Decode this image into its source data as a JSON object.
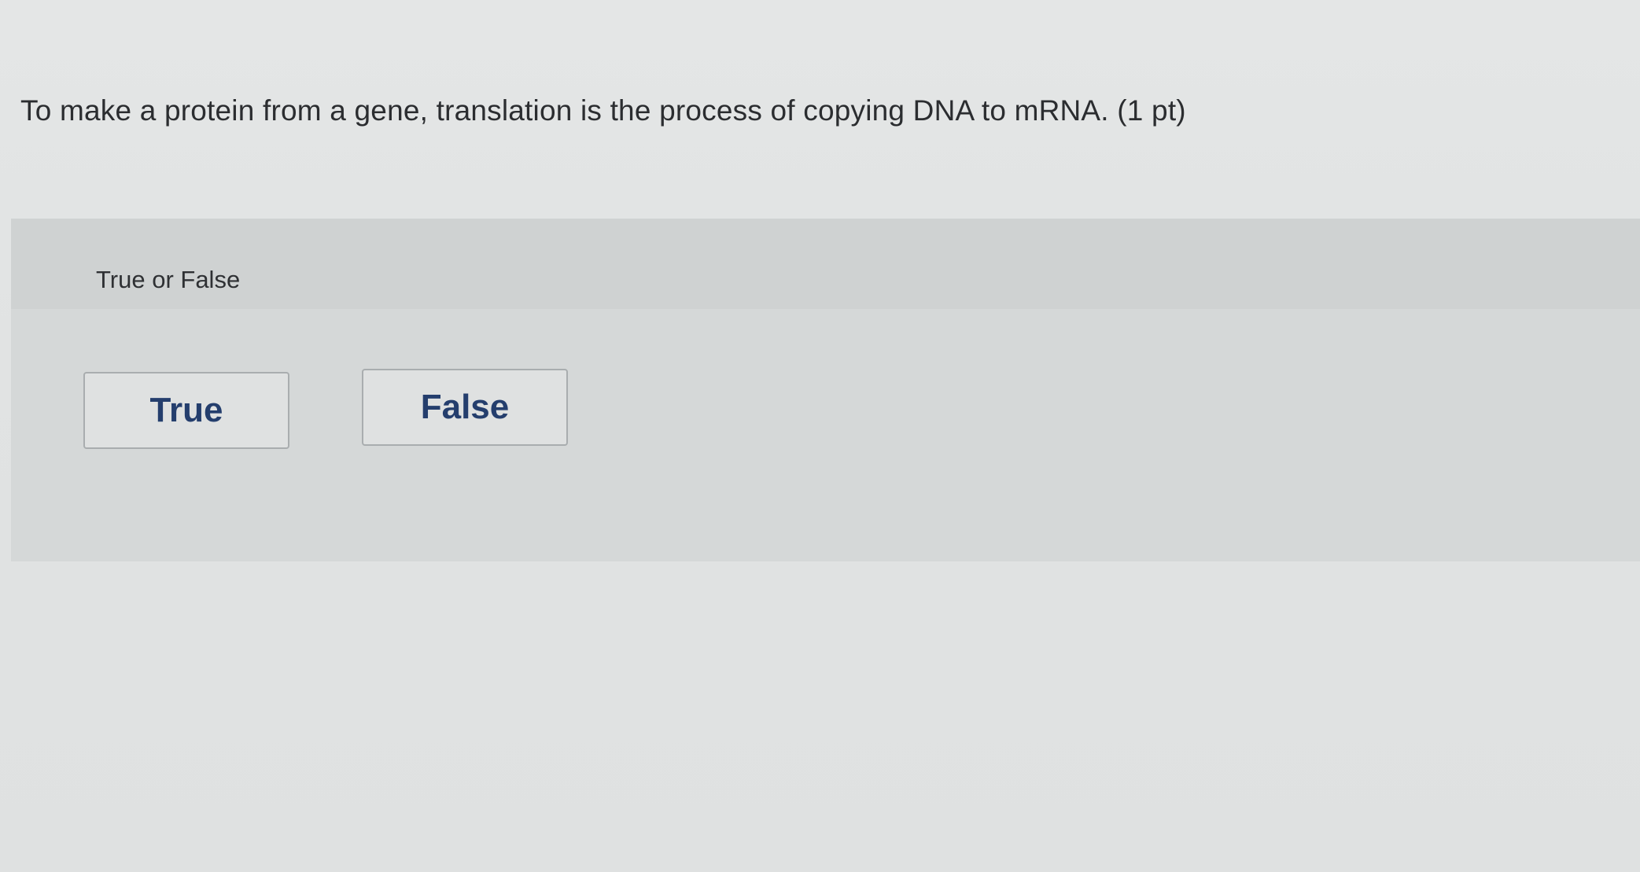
{
  "question": {
    "text": "To make a protein from a gene, translation is the process of copying DNA to mRNA. (1 pt)"
  },
  "answer_area": {
    "prompt": "True or False",
    "choices": [
      {
        "label": "True"
      },
      {
        "label": "False"
      }
    ]
  },
  "colors": {
    "page_background": "#e2e4e4",
    "panel_background": "#d5d8d8",
    "button_text": "#243e6d",
    "button_border": "#a9adaf"
  }
}
